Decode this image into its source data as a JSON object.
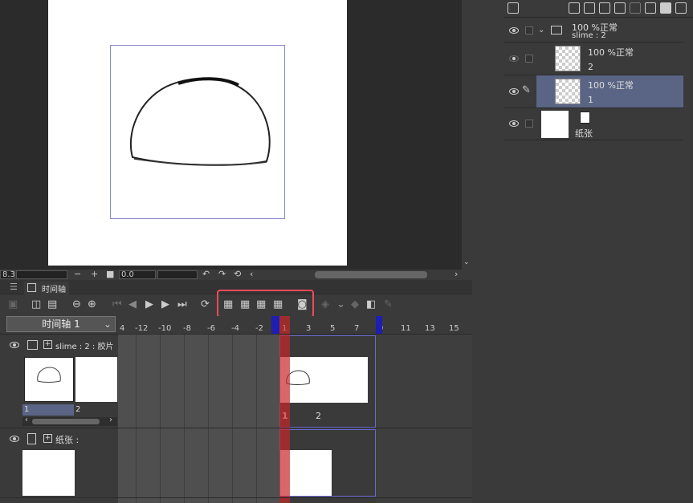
{
  "canvas": {
    "zoom_value": "8.3",
    "rotation_value": "0.0"
  },
  "layers": {
    "folder": {
      "opacity_mode": "100 %正常",
      "name": "slime : 2"
    },
    "cel2": {
      "opacity_mode": "100 %正常",
      "name": "2"
    },
    "cel1": {
      "opacity_mode": "100 %正常",
      "name": "1"
    },
    "paper": {
      "name": "纸张"
    }
  },
  "timeline": {
    "tab_label": "时间轴",
    "selector_value": "时间轴 1",
    "ruler_labels": [
      "4",
      "-12",
      "-10",
      "-8",
      "-6",
      "-4",
      "-2",
      "1",
      "3",
      "5",
      "7",
      "9",
      "11",
      "13",
      "15"
    ],
    "track1_label": "slime : 2 : 胶片",
    "track1_cel_labels": [
      "1",
      "2"
    ],
    "track1_timeline_cels": [
      "1",
      "2"
    ],
    "track2_label": "纸张 :",
    "colors": {
      "highlight": "#f04a5a",
      "playhead": "#c82828",
      "range_marker": "#1e1eb0",
      "selected_layer": "#5a6585"
    }
  }
}
